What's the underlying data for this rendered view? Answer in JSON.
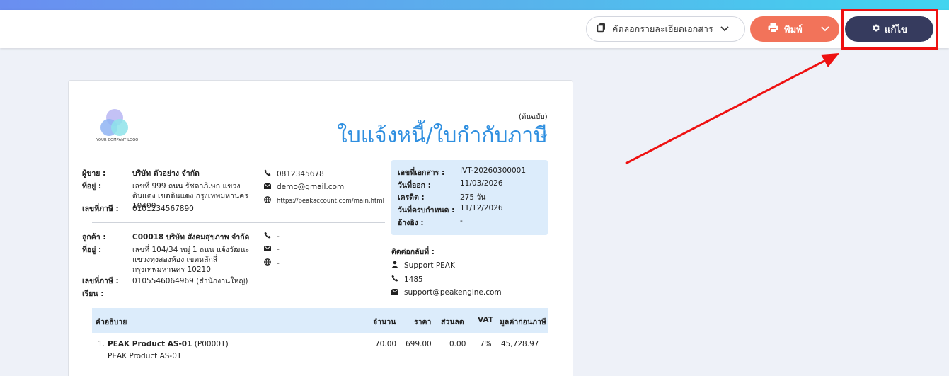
{
  "toolbar": {
    "copy_label": "คัดลอกรายละเอียดเอกสาร",
    "print_label": "พิมพ์",
    "edit_label": "แก้ไข"
  },
  "document": {
    "copy_type": "(ต้นฉบับ)",
    "title": "ใบแจ้งหนี้/ใบกำกับภาษี",
    "logo_text": "YOUR COMPANY LOGO",
    "seller": {
      "label_seller": "ผู้ขาย :",
      "name": "บริษัท ตัวอย่าง จำกัด",
      "label_address": "ที่อยู่ :",
      "address": "เลขที่ 999 ถนน รัชดาภิเษก แขวงดินแดง เขตดินแดง กรุงเทพมหานคร 10400",
      "label_taxid": "เลขที่ภาษี :",
      "taxid": "0101234567890",
      "phone": "0812345678",
      "email": "demo@gmail.com",
      "website": "https://peakaccount.com/main.html"
    },
    "customer": {
      "label_customer": "ลูกค้า :",
      "name": "C00018 บริษัท สังคมสุขภาพ จำกัด",
      "label_address": "ที่อยู่ :",
      "address": "เลขที่ 104/34 หมู่ 1 ถนน แจ้งวัฒนะ แขวงทุ่งสองห้อง เขตหลักสี่ กรุงเทพมหานคร 10210",
      "label_taxid": "เลขที่ภาษี :",
      "taxid": "0105546064969 (สำนักงานใหญ่)",
      "label_attn": "เรียน :",
      "phone": "-",
      "email": "-",
      "website": "-"
    },
    "meta": {
      "doc_no_label": "เลขที่เอกสาร :",
      "doc_no": "IVT-20260300001",
      "issue_label": "วันที่ออก :",
      "issue_date": "11/03/2026",
      "credit_label": "เครดิต :",
      "credit": "275 วัน",
      "due_label": "วันที่ครบกำหนด :",
      "due_date": "11/12/2026",
      "ref_label": "อ้างอิง :",
      "ref": "-"
    },
    "contact_us": {
      "title": "ติดต่อกลับที่ :",
      "name": "Support PEAK",
      "phone": "1485",
      "email": "support@peakengine.com"
    },
    "table": {
      "headers": {
        "description": "คำอธิบาย",
        "qty": "จำนวน",
        "price": "ราคา",
        "discount": "ส่วนลด",
        "vat": "VAT",
        "amount": "มูลค่าก่อนภาษี"
      },
      "rows": [
        {
          "no": "1.",
          "name": "PEAK Product AS-01",
          "code": "(P00001)",
          "desc": "PEAK Product AS-01",
          "qty": "70.00",
          "price": "699.00",
          "discount": "0.00",
          "vat": "7%",
          "amount": "45,728.97"
        }
      ]
    }
  },
  "colors": {
    "accent_blue": "#2f8fe0",
    "print_button": "#f2735a",
    "edit_button": "#363b5e",
    "highlight_red": "#ee1111"
  }
}
